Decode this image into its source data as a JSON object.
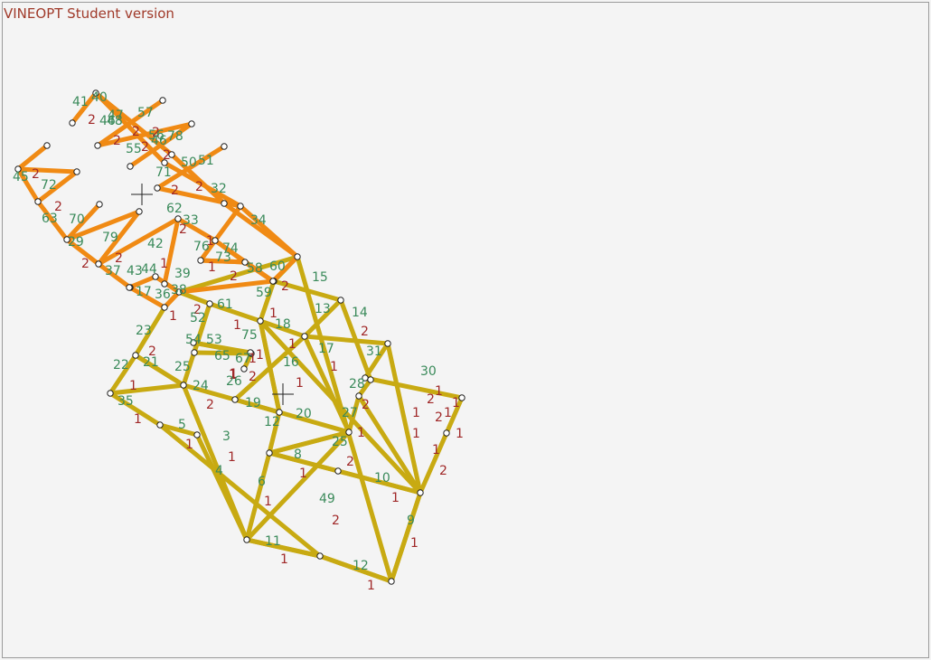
{
  "app": {
    "title": "VINEOPT Student version"
  },
  "colors": {
    "major_road": "#c8aa12",
    "minor_road": "#f08a14",
    "node_fill": "#ffffff",
    "node_stroke": "#222222",
    "id_label": "#3a8a5a",
    "value_label": "#a02828",
    "title": "#a03a2a"
  },
  "network": {
    "major_edges": [
      [
        "A",
        "B"
      ],
      [
        "B",
        "C"
      ],
      [
        "C",
        "D"
      ],
      [
        "D",
        "E"
      ],
      [
        "E",
        "F"
      ],
      [
        "F",
        "G"
      ],
      [
        "G",
        "H"
      ],
      [
        "H",
        "I"
      ],
      [
        "I",
        "J"
      ],
      [
        "J",
        "A"
      ],
      [
        "K",
        "L"
      ],
      [
        "L",
        "M"
      ],
      [
        "M",
        "N"
      ],
      [
        "N",
        "O"
      ],
      [
        "P",
        "Q"
      ],
      [
        "Q",
        "R"
      ],
      [
        "R",
        "S"
      ],
      [
        "S",
        "T"
      ],
      [
        "B",
        "P"
      ],
      [
        "P",
        "Q"
      ],
      [
        "Q",
        "K"
      ],
      [
        "J",
        "U"
      ],
      [
        "U",
        "L"
      ],
      [
        "L",
        "S"
      ],
      [
        "U",
        "V"
      ],
      [
        "V",
        "W"
      ],
      [
        "X",
        "Y"
      ],
      [
        "Y",
        "M"
      ],
      [
        "D",
        "R"
      ],
      [
        "R",
        "M"
      ],
      [
        "E",
        "Z"
      ],
      [
        "Z",
        "N"
      ],
      [
        "C",
        "O"
      ],
      [
        "A",
        "AA"
      ],
      [
        "AA",
        "AB"
      ],
      [
        "AA",
        "AC"
      ],
      [
        "AC",
        "AD"
      ],
      [
        "AD",
        "AE"
      ],
      [
        "AE",
        "AF"
      ],
      [
        "AE",
        "AG"
      ],
      [
        "AG",
        "AH"
      ],
      [
        "AI",
        "AJ"
      ],
      [
        "AJ",
        "AK"
      ],
      [
        "AB",
        "AL"
      ],
      [
        "AL",
        "AM"
      ],
      [
        "AI",
        "AM"
      ],
      [
        "AN",
        "AM"
      ],
      [
        "AN",
        "AO"
      ],
      [
        "AO",
        "AP"
      ],
      [
        "AP",
        "AQ"
      ],
      [
        "AQ",
        "AR"
      ],
      [
        "AR",
        "AS"
      ],
      [
        "AS",
        "AT"
      ],
      [
        "AT",
        "AO"
      ],
      [
        "AU",
        "AV"
      ],
      [
        "AV",
        "AW"
      ],
      [
        "AW",
        "AX"
      ],
      [
        "AX",
        "AY"
      ],
      [
        "AY",
        "AS"
      ]
    ],
    "minor_edges": [
      [
        "M1",
        "M2"
      ],
      [
        "M2",
        "M3"
      ],
      [
        "M3",
        "M4"
      ],
      [
        "M4",
        "M5"
      ],
      [
        "M5",
        "M6"
      ],
      [
        "M6",
        "M7"
      ],
      [
        "M7",
        "M8"
      ],
      [
        "M8",
        "M9"
      ],
      [
        "M10",
        "M11"
      ],
      [
        "M11",
        "M12"
      ],
      [
        "M12",
        "M13"
      ],
      [
        "M13",
        "M14"
      ],
      [
        "M15",
        "M16"
      ],
      [
        "M16",
        "M17"
      ],
      [
        "M17",
        "M18"
      ],
      [
        "M19",
        "M20"
      ],
      [
        "M20",
        "M21"
      ],
      [
        "M21",
        "M22"
      ],
      [
        "M22",
        "M23"
      ],
      [
        "M23",
        "M24"
      ],
      [
        "M25",
        "M26"
      ],
      [
        "M26",
        "M27"
      ],
      [
        "M27",
        "M28"
      ],
      [
        "M29",
        "M30"
      ],
      [
        "M30",
        "M31"
      ],
      [
        "M31",
        "M32"
      ],
      [
        "M32",
        "M33"
      ],
      [
        "M34",
        "M35"
      ],
      [
        "M35",
        "M36"
      ],
      [
        "M36",
        "M37"
      ],
      [
        "M37",
        "M38"
      ],
      [
        "M39",
        "M40"
      ],
      [
        "M40",
        "M41"
      ],
      [
        "M41",
        "M42"
      ],
      [
        "M43",
        "M44"
      ],
      [
        "M44",
        "M45"
      ],
      [
        "M45",
        "M46"
      ],
      [
        "M47",
        "M48"
      ],
      [
        "M48",
        "M49"
      ]
    ],
    "labels": [
      {
        "t": "41",
        "c": "id"
      },
      {
        "t": "40",
        "c": "id"
      },
      {
        "t": "2",
        "c": "val"
      },
      {
        "t": "46",
        "c": "id"
      },
      {
        "t": "47",
        "c": "id"
      },
      {
        "t": "57",
        "c": "id"
      },
      {
        "t": "48",
        "c": "id"
      },
      {
        "t": "2",
        "c": "val"
      },
      {
        "t": "2",
        "c": "val"
      },
      {
        "t": "56",
        "c": "id"
      },
      {
        "t": "78",
        "c": "id"
      },
      {
        "t": "55",
        "c": "id"
      },
      {
        "t": "2",
        "c": "val"
      },
      {
        "t": "2",
        "c": "val"
      },
      {
        "t": "46",
        "c": "id"
      },
      {
        "t": "2",
        "c": "val"
      },
      {
        "t": "71",
        "c": "id"
      },
      {
        "t": "50",
        "c": "id"
      },
      {
        "t": "51",
        "c": "id"
      },
      {
        "t": "45",
        "c": "id"
      },
      {
        "t": "2",
        "c": "val"
      },
      {
        "t": "72",
        "c": "id"
      },
      {
        "t": "2",
        "c": "val"
      },
      {
        "t": "2",
        "c": "val"
      },
      {
        "t": "32",
        "c": "id"
      },
      {
        "t": "2",
        "c": "val"
      },
      {
        "t": "62",
        "c": "id"
      },
      {
        "t": "63",
        "c": "id"
      },
      {
        "t": "70",
        "c": "id"
      },
      {
        "t": "33",
        "c": "id"
      },
      {
        "t": "34",
        "c": "id"
      },
      {
        "t": "2",
        "c": "val"
      },
      {
        "t": "29",
        "c": "id"
      },
      {
        "t": "79",
        "c": "id"
      },
      {
        "t": "42",
        "c": "id"
      },
      {
        "t": "76",
        "c": "id"
      },
      {
        "t": "73",
        "c": "id"
      },
      {
        "t": "74",
        "c": "id"
      },
      {
        "t": "1",
        "c": "val"
      },
      {
        "t": "2",
        "c": "val"
      },
      {
        "t": "1",
        "c": "val"
      },
      {
        "t": "2",
        "c": "val"
      },
      {
        "t": "37",
        "c": "id"
      },
      {
        "t": "43",
        "c": "id"
      },
      {
        "t": "44",
        "c": "id"
      },
      {
        "t": "1",
        "c": "val"
      },
      {
        "t": "39",
        "c": "id"
      },
      {
        "t": "58",
        "c": "id"
      },
      {
        "t": "60",
        "c": "id"
      },
      {
        "t": "2",
        "c": "val"
      },
      {
        "t": "2",
        "c": "val"
      },
      {
        "t": "17",
        "c": "id"
      },
      {
        "t": "36",
        "c": "id"
      },
      {
        "t": "38",
        "c": "id"
      },
      {
        "t": "15",
        "c": "id"
      },
      {
        "t": "59",
        "c": "id"
      },
      {
        "t": "2",
        "c": "val"
      },
      {
        "t": "1",
        "c": "val"
      },
      {
        "t": "1",
        "c": "val"
      },
      {
        "t": "61",
        "c": "id"
      },
      {
        "t": "52",
        "c": "id"
      },
      {
        "t": "13",
        "c": "id"
      },
      {
        "t": "14",
        "c": "id"
      },
      {
        "t": "1",
        "c": "val"
      },
      {
        "t": "18",
        "c": "id"
      },
      {
        "t": "1",
        "c": "val"
      },
      {
        "t": "23",
        "c": "id"
      },
      {
        "t": "54",
        "c": "id"
      },
      {
        "t": "53",
        "c": "id"
      },
      {
        "t": "75",
        "c": "id"
      },
      {
        "t": "1",
        "c": "val"
      },
      {
        "t": "17",
        "c": "id"
      },
      {
        "t": "2",
        "c": "val"
      },
      {
        "t": "31",
        "c": "id"
      },
      {
        "t": "2",
        "c": "val"
      },
      {
        "t": "65",
        "c": "id"
      },
      {
        "t": "67",
        "c": "id"
      },
      {
        "t": "1",
        "c": "val"
      },
      {
        "t": "22",
        "c": "id"
      },
      {
        "t": "21",
        "c": "id"
      },
      {
        "t": "25",
        "c": "id"
      },
      {
        "t": "16",
        "c": "id"
      },
      {
        "t": "1",
        "c": "val"
      },
      {
        "t": "30",
        "c": "id"
      },
      {
        "t": "1",
        "c": "val"
      },
      {
        "t": "26",
        "c": "id"
      },
      {
        "t": "1",
        "c": "val"
      },
      {
        "t": "2",
        "c": "val"
      },
      {
        "t": "1",
        "c": "val"
      },
      {
        "t": "24",
        "c": "id"
      },
      {
        "t": "28",
        "c": "id"
      },
      {
        "t": "1",
        "c": "val"
      },
      {
        "t": "35",
        "c": "id"
      },
      {
        "t": "2",
        "c": "val"
      },
      {
        "t": "19",
        "c": "id"
      },
      {
        "t": "2",
        "c": "val"
      },
      {
        "t": "27",
        "c": "id"
      },
      {
        "t": "1",
        "c": "val"
      },
      {
        "t": "1",
        "c": "val"
      },
      {
        "t": "12",
        "c": "id"
      },
      {
        "t": "20",
        "c": "id"
      },
      {
        "t": "1",
        "c": "val"
      },
      {
        "t": "1",
        "c": "val"
      },
      {
        "t": "1",
        "c": "val"
      },
      {
        "t": "1",
        "c": "val"
      },
      {
        "t": "5",
        "c": "id"
      },
      {
        "t": "25",
        "c": "id"
      },
      {
        "t": "1",
        "c": "val"
      },
      {
        "t": "1",
        "c": "val"
      },
      {
        "t": "3",
        "c": "id"
      },
      {
        "t": "1",
        "c": "val"
      },
      {
        "t": "8",
        "c": "id"
      },
      {
        "t": "2",
        "c": "val"
      },
      {
        "t": "1",
        "c": "val"
      },
      {
        "t": "4",
        "c": "id"
      },
      {
        "t": "6",
        "c": "id"
      },
      {
        "t": "1",
        "c": "val"
      },
      {
        "t": "10",
        "c": "id"
      },
      {
        "t": "2",
        "c": "val"
      },
      {
        "t": "1",
        "c": "val"
      },
      {
        "t": "2",
        "c": "val"
      },
      {
        "t": "1",
        "c": "val"
      },
      {
        "t": "49",
        "c": "id"
      },
      {
        "t": "2",
        "c": "val"
      },
      {
        "t": "9",
        "c": "id"
      },
      {
        "t": "1",
        "c": "val"
      },
      {
        "t": "11",
        "c": "id"
      },
      {
        "t": "1",
        "c": "val"
      },
      {
        "t": "12",
        "c": "id"
      },
      {
        "t": "1",
        "c": "val"
      },
      {
        "t": "1",
        "c": "val"
      },
      {
        "t": "2",
        "c": "val"
      }
    ],
    "cursors": 2
  }
}
